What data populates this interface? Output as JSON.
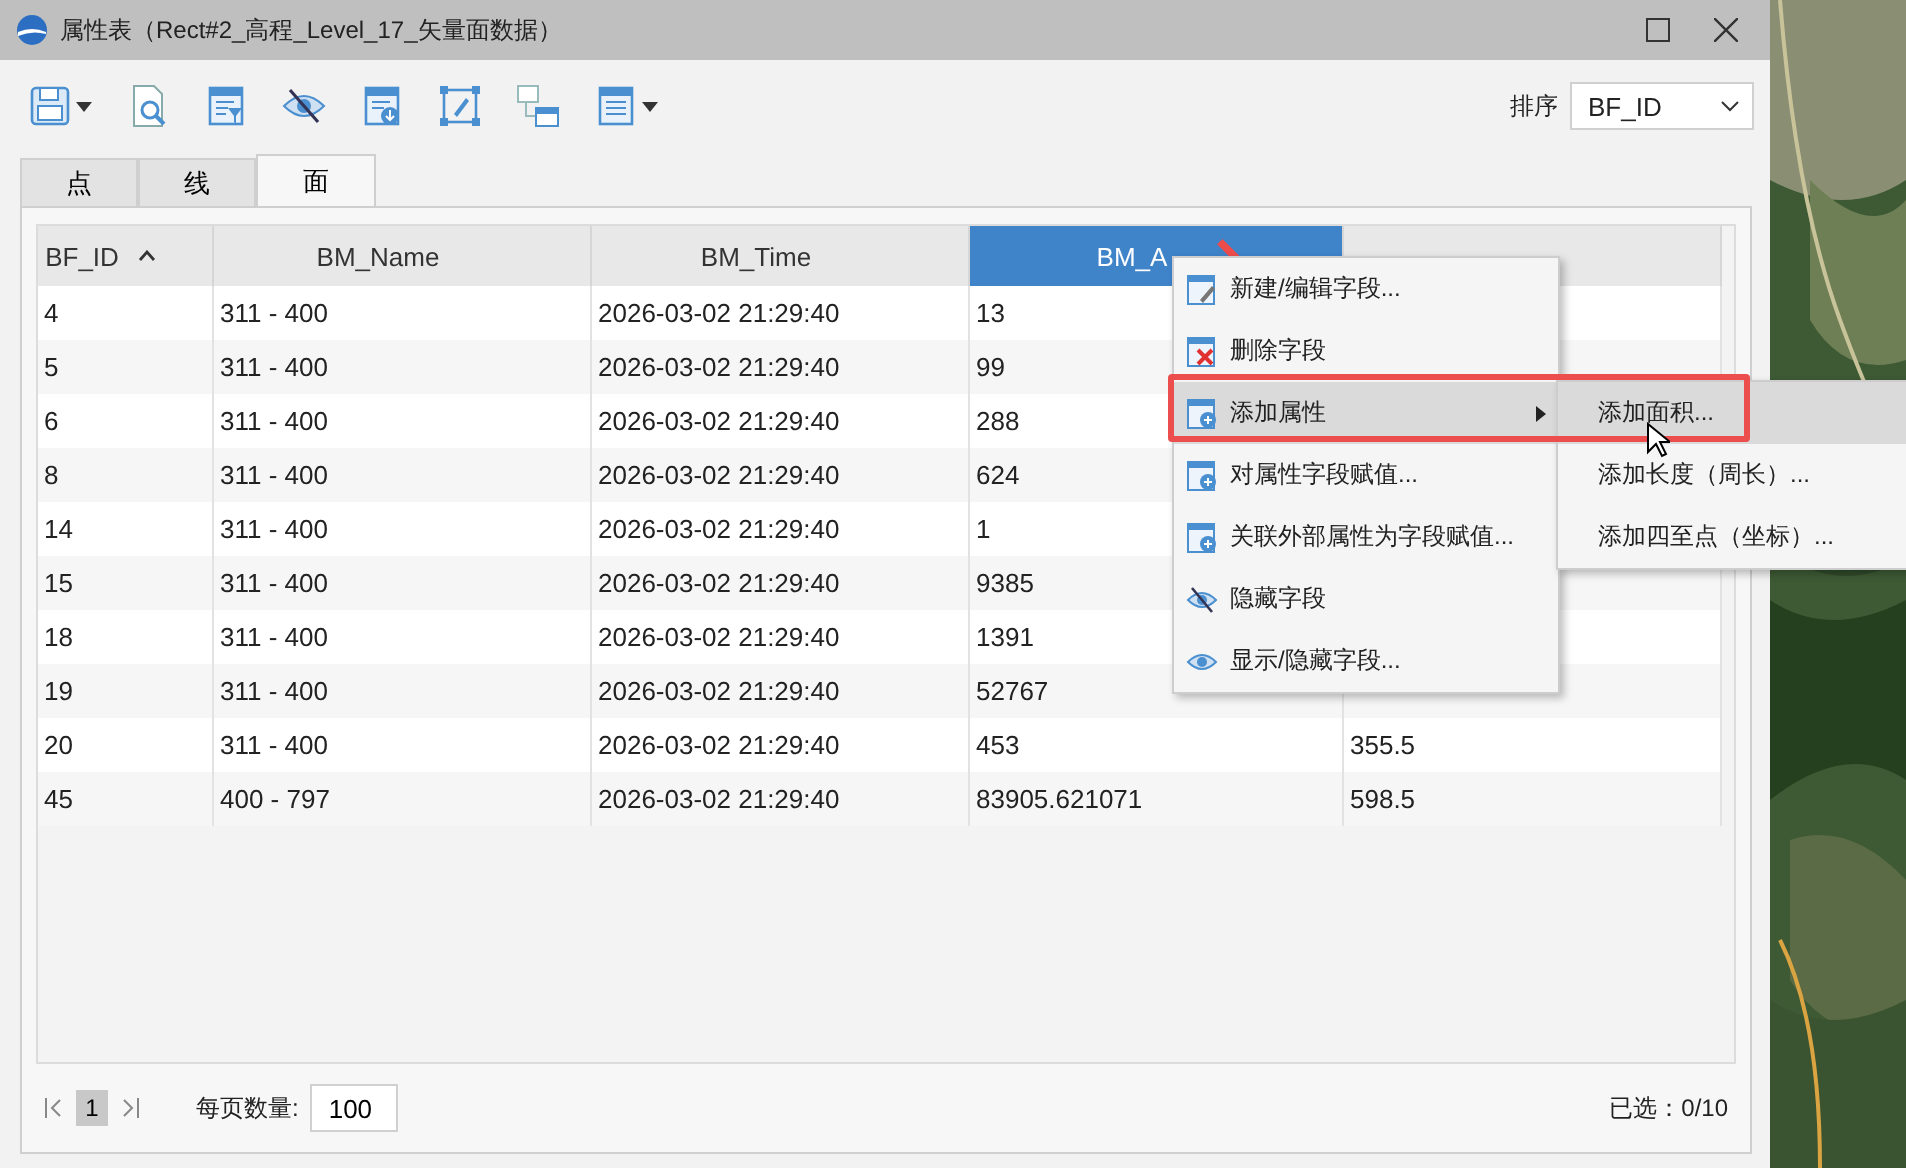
{
  "window": {
    "title": "属性表（Rect#2_高程_Level_17_矢量面数据）"
  },
  "sort": {
    "label": "排序",
    "value": "BF_ID"
  },
  "tabs": [
    {
      "label": "点",
      "selected": false
    },
    {
      "label": "线",
      "selected": false
    },
    {
      "label": "面",
      "selected": true
    }
  ],
  "table": {
    "columns": [
      {
        "label": "BF_ID",
        "sorted": true,
        "selected": false
      },
      {
        "label": "BM_Name",
        "sorted": false,
        "selected": false
      },
      {
        "label": "BM_Time",
        "sorted": false,
        "selected": false
      },
      {
        "label": "BM_A",
        "sorted": false,
        "selected": true
      },
      {
        "sorted": false,
        "selected": false
      }
    ],
    "rows": [
      [
        "4",
        "311 - 400",
        "2026-03-02 21:29:40",
        "13"
      ],
      [
        "5",
        "311 - 400",
        "2026-03-02 21:29:40",
        "99"
      ],
      [
        "6",
        "311 - 400",
        "2026-03-02 21:29:40",
        "288"
      ],
      [
        "8",
        "311 - 400",
        "2026-03-02 21:29:40",
        "624"
      ],
      [
        "14",
        "311 - 400",
        "2026-03-02 21:29:40",
        "1"
      ],
      [
        "15",
        "311 - 400",
        "2026-03-02 21:29:40",
        "9385"
      ],
      [
        "18",
        "311 - 400",
        "2026-03-02 21:29:40",
        "1391"
      ],
      [
        "19",
        "311 - 400",
        "2026-03-02 21:29:40",
        "52767"
      ],
      [
        "20",
        "311 - 400",
        "2026-03-02 21:29:40",
        "453",
        "355.5"
      ],
      [
        "45",
        "400 - 797",
        "2026-03-02 21:29:40",
        "83905.621071",
        "598.5"
      ]
    ]
  },
  "context_menu": {
    "items": [
      {
        "label": "新建/编辑字段...",
        "kind": "edit",
        "selected": false,
        "submenu": false
      },
      {
        "label": "删除字段",
        "kind": "delete",
        "selected": false,
        "submenu": false
      },
      {
        "label": "添加属性",
        "kind": "add",
        "selected": true,
        "submenu": true
      },
      {
        "label": "对属性字段赋值...",
        "kind": "add",
        "selected": false,
        "submenu": false
      },
      {
        "label": "关联外部属性为字段赋值...",
        "kind": "add",
        "selected": false,
        "submenu": false
      },
      {
        "label": "隐藏字段",
        "kind": "hide",
        "selected": false,
        "submenu": false
      },
      {
        "label": "显示/隐藏字段...",
        "kind": "show",
        "selected": false,
        "submenu": false
      }
    ]
  },
  "submenu": {
    "items": [
      {
        "label": "添加面积...",
        "selected": true
      },
      {
        "label": "添加长度（周长）...",
        "selected": false
      },
      {
        "label": "添加四至点（坐标）...",
        "selected": false
      }
    ]
  },
  "pager": {
    "page": "1",
    "page_size_label": "每页数量:",
    "page_size": "100",
    "selection": "已选：0/10"
  }
}
